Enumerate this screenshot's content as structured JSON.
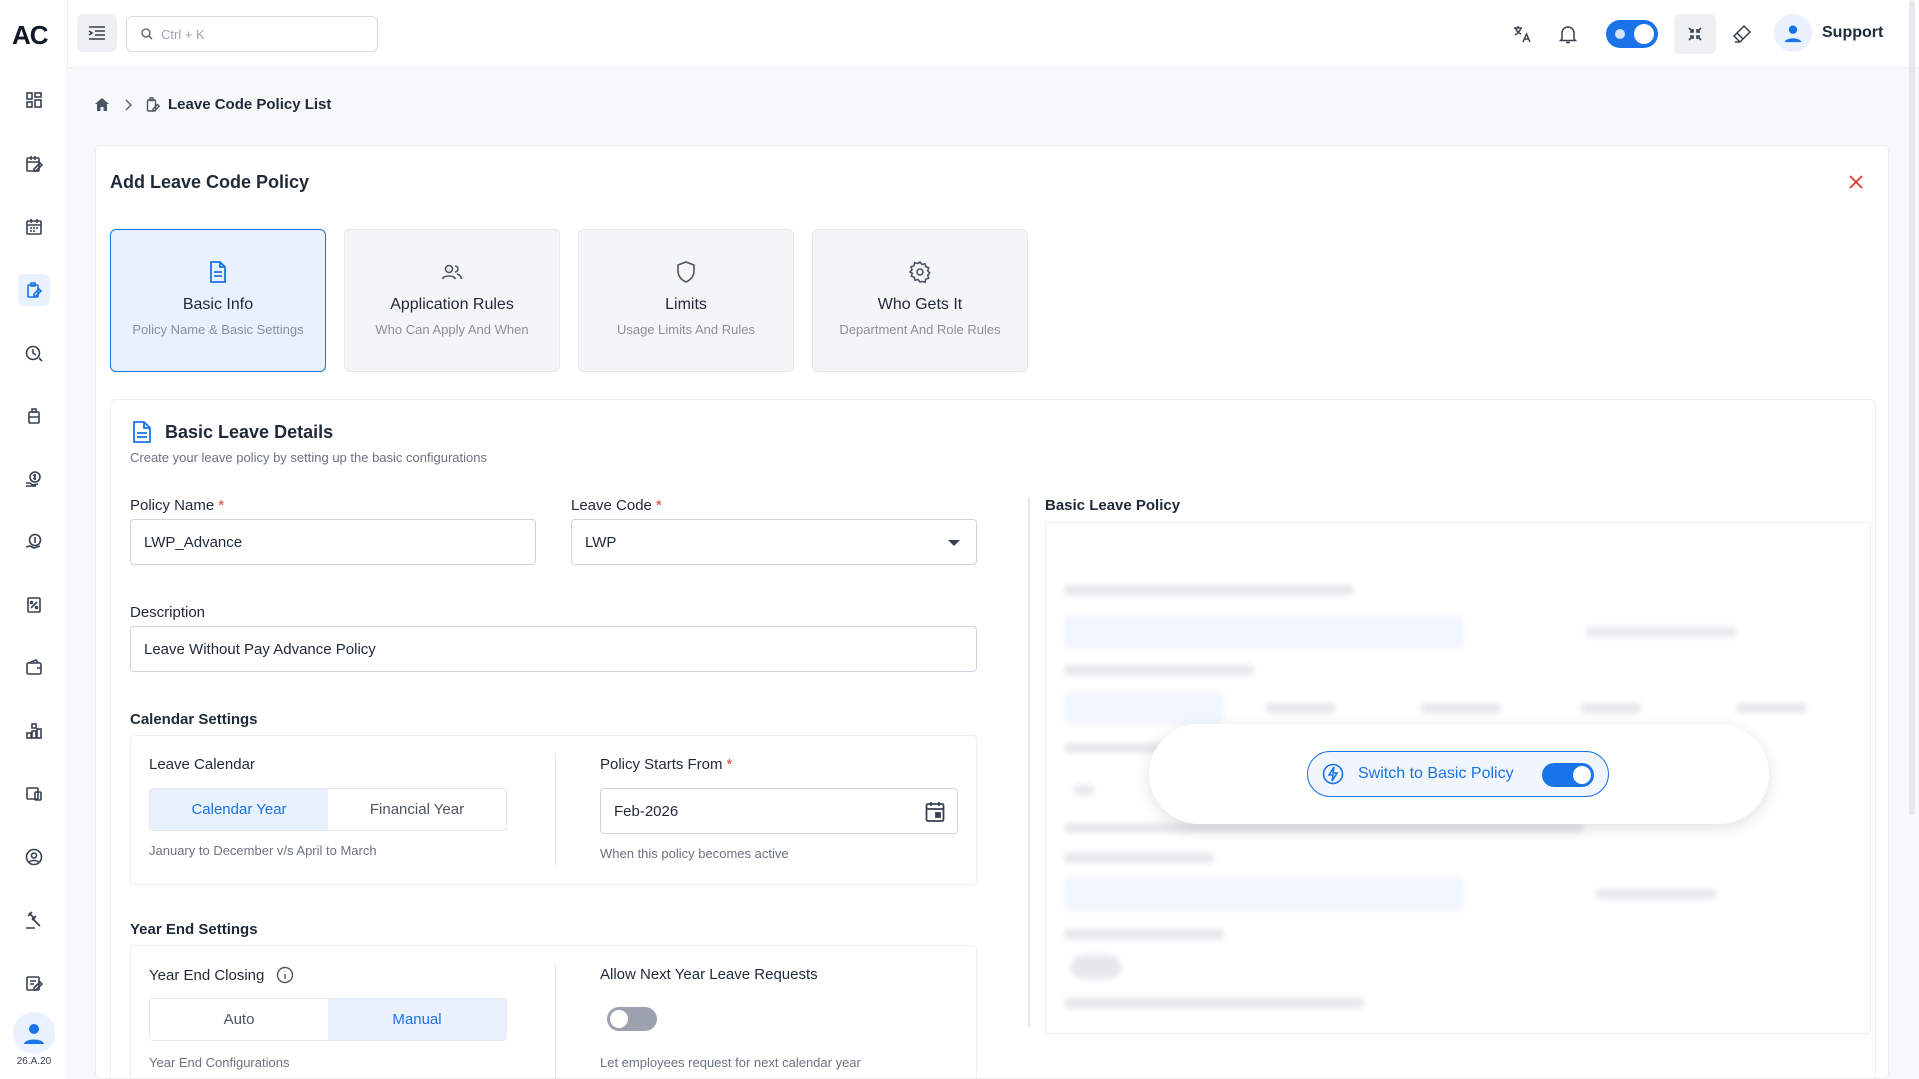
{
  "app": {
    "logo": "AC",
    "version": "26.A.20"
  },
  "topbar": {
    "search_placeholder": "Ctrl + K",
    "user_name": "Support"
  },
  "breadcrumb": {
    "current": "Leave Code Policy List"
  },
  "page": {
    "title": "Add Leave Code Policy"
  },
  "steps": [
    {
      "title": "Basic Info",
      "subtitle": "Policy Name & Basic Settings",
      "icon": "document-icon",
      "active": true
    },
    {
      "title": "Application Rules",
      "subtitle": "Who Can Apply And When",
      "icon": "users-icon",
      "active": false
    },
    {
      "title": "Limits",
      "subtitle": "Usage Limits And Rules",
      "icon": "shield-icon",
      "active": false
    },
    {
      "title": "Who Gets It",
      "subtitle": "Department And Role Rules",
      "icon": "gear-icon",
      "active": false
    }
  ],
  "section": {
    "title": "Basic Leave Details",
    "subtitle": "Create your leave policy by setting up the basic configurations"
  },
  "form": {
    "policy_name": {
      "label": "Policy Name",
      "required": "*",
      "value": "LWP_Advance"
    },
    "leave_code": {
      "label": "Leave Code",
      "required": "*",
      "value": "LWP"
    },
    "description": {
      "label": "Description",
      "value": "Leave Without Pay Advance Policy"
    },
    "calendar_settings": {
      "heading": "Calendar Settings",
      "leave_calendar_label": "Leave Calendar",
      "options": [
        "Calendar Year",
        "Financial Year"
      ],
      "selected": "Calendar Year",
      "hint": "January to December v/s April to March",
      "policy_start_label": "Policy Starts From",
      "policy_start_required": "*",
      "policy_start_value": "Feb-2026",
      "policy_start_hint": "When this policy becomes active"
    },
    "year_end_settings": {
      "heading": "Year End Settings",
      "closing_label": "Year End Closing",
      "options": [
        "Auto",
        "Manual"
      ],
      "selected": "Manual",
      "hint": "Year End Configurations",
      "next_year_label": "Allow Next Year Leave Requests",
      "next_year_enabled": false,
      "next_year_hint": "Let employees request for next calendar year"
    }
  },
  "right_panel": {
    "title": "Basic Leave Policy",
    "switch_label": "Switch to Basic Policy",
    "switch_on": true
  },
  "colors": {
    "accent": "#1a73e8",
    "required": "#e53935",
    "active_bg": "#e8f1fd"
  }
}
